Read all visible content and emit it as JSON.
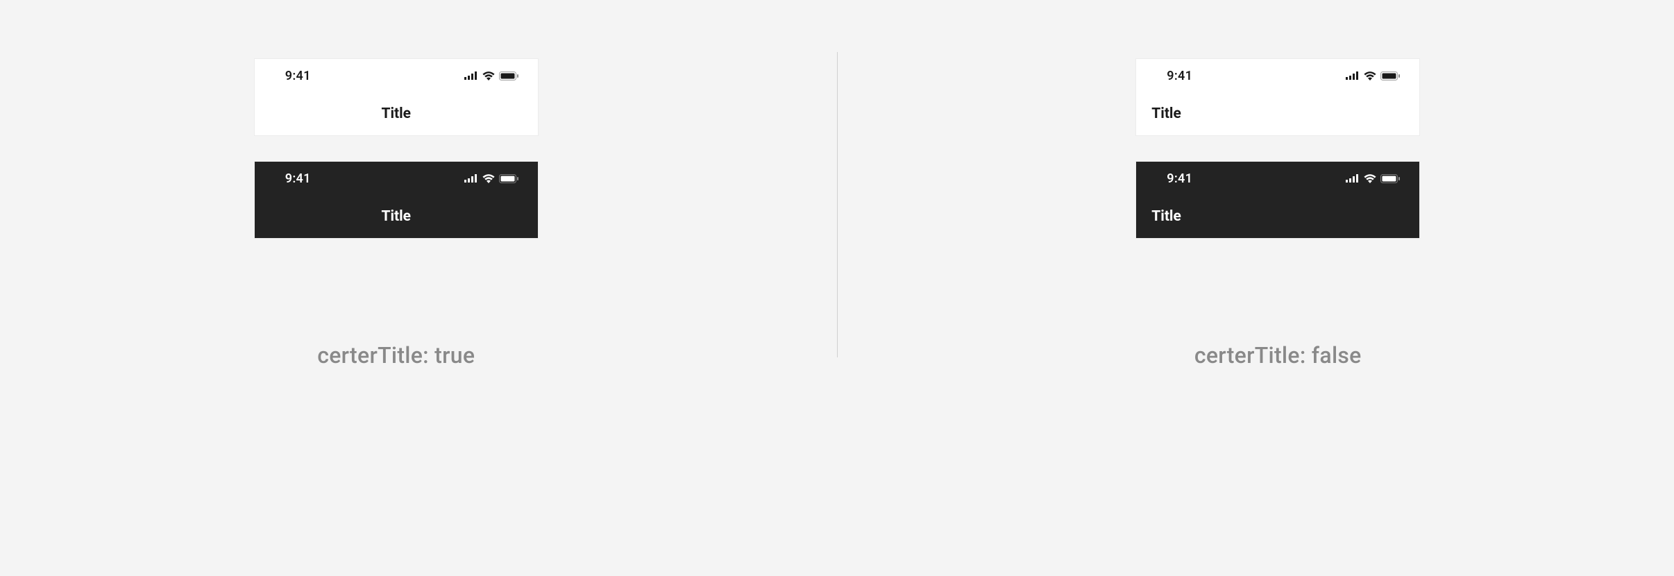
{
  "status": {
    "time": "9:41"
  },
  "appbar": {
    "title": "Title"
  },
  "captions": {
    "left": "certerTitle: true",
    "right": "certerTitle: false"
  }
}
